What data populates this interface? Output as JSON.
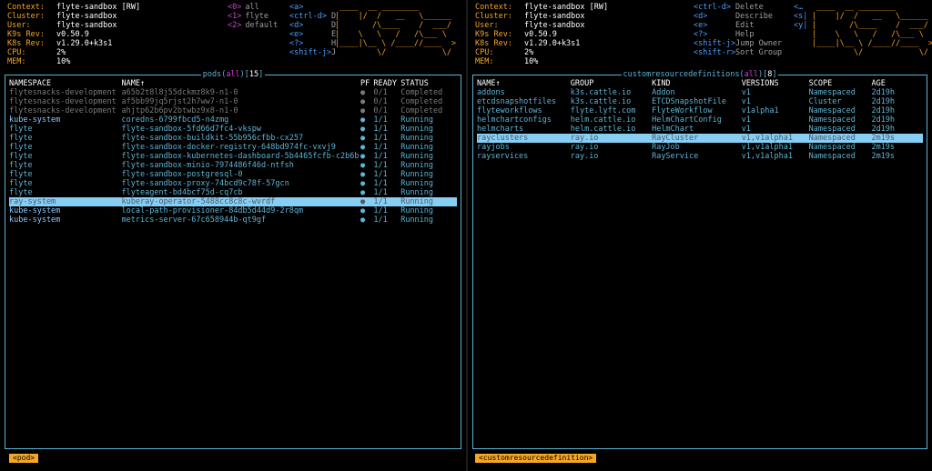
{
  "left": {
    "info": [
      {
        "key": "Context:",
        "value": "flyte-sandbox [RW]"
      },
      {
        "key": "Cluster:",
        "value": "flyte-sandbox"
      },
      {
        "key": "User:",
        "value": "flyte-sandbox"
      },
      {
        "key": "K9s Rev:",
        "value": "v0.50.9"
      },
      {
        "key": "K8s Rev:",
        "value": "v1.29.0+k3s1"
      },
      {
        "key": "CPU:",
        "value": "2%"
      },
      {
        "key": "MEM:",
        "value": "10%"
      }
    ],
    "namespaces": [
      {
        "key": "<0>",
        "value": "all"
      },
      {
        "key": "<1>",
        "value": "flyte"
      },
      {
        "key": "<2>",
        "value": "default"
      }
    ],
    "keys": [
      {
        "hint": "<a>",
        "desc": ""
      },
      {
        "hint": "<ctrl-d>",
        "desc": "D"
      },
      {
        "hint": "<d>",
        "desc": "D"
      },
      {
        "hint": "<e>",
        "desc": "E"
      },
      {
        "hint": "<?>",
        "desc": "H"
      },
      {
        "hint": "<shift-j>",
        "desc": "J"
      }
    ],
    "logo": " ____  __ ________\n|    |/  /   __   \\______\n|       /\\____    /  ___/\n|    \\   \\   /   /\\___ \\\n|____|\\__ \\ /____//____  >\n         \\/            \\/",
    "frame": {
      "name": "pods",
      "filter": "all",
      "count": "15"
    },
    "columns": [
      "NAMESPACE",
      "NAME↑",
      "PF",
      "READY",
      "STATUS"
    ],
    "rows": [
      {
        "ns": "flytesnacks-development",
        "name": "a65b2t8l8j55dckmz8k9-n1-0",
        "pf": "●",
        "ready": "0/1",
        "status": "Completed",
        "kind": "completed"
      },
      {
        "ns": "flytesnacks-development",
        "name": "af5bb99jq5rjst2h7ww7-n1-0",
        "pf": "●",
        "ready": "0/1",
        "status": "Completed",
        "kind": "completed"
      },
      {
        "ns": "flytesnacks-development",
        "name": "ahjtp62b6pv2btwbz9x8-n1-0",
        "pf": "●",
        "ready": "0/1",
        "status": "Completed",
        "kind": "completed"
      },
      {
        "ns": "kube-system",
        "name": "coredns-6799fbcd5-n4zmg",
        "pf": "●",
        "ready": "1/1",
        "status": "Running",
        "kind": "running"
      },
      {
        "ns": "flyte",
        "name": "flyte-sandbox-5fd66d7fc4-vkspw",
        "pf": "●",
        "ready": "1/1",
        "status": "Running",
        "kind": "running"
      },
      {
        "ns": "flyte",
        "name": "flyte-sandbox-buildkit-55b956cfbb-cx257",
        "pf": "●",
        "ready": "1/1",
        "status": "Running",
        "kind": "running"
      },
      {
        "ns": "flyte",
        "name": "flyte-sandbox-docker-registry-648bd974fc-vxvj9",
        "pf": "●",
        "ready": "1/1",
        "status": "Running",
        "kind": "running"
      },
      {
        "ns": "flyte",
        "name": "flyte-sandbox-kubernetes-dashboard-5b4465fcfb-c2b6b",
        "pf": "●",
        "ready": "1/1",
        "status": "Running",
        "kind": "running"
      },
      {
        "ns": "flyte",
        "name": "flyte-sandbox-minio-7974486f46d-ntfsh",
        "pf": "●",
        "ready": "1/1",
        "status": "Running",
        "kind": "running"
      },
      {
        "ns": "flyte",
        "name": "flyte-sandbox-postgresql-0",
        "pf": "●",
        "ready": "1/1",
        "status": "Running",
        "kind": "running"
      },
      {
        "ns": "flyte",
        "name": "flyte-sandbox-proxy-74bcd9c78f-57gcn",
        "pf": "●",
        "ready": "1/1",
        "status": "Running",
        "kind": "running"
      },
      {
        "ns": "flyte",
        "name": "flyteagent-bd4bcf75d-cq7cb",
        "pf": "●",
        "ready": "1/1",
        "status": "Running",
        "kind": "running"
      },
      {
        "ns": "ray-system",
        "name": "kuberay-operator-5488cc8c8c-wvrdf",
        "pf": "●",
        "ready": "1/1",
        "status": "Running",
        "kind": "selected"
      },
      {
        "ns": "kube-system",
        "name": "local-path-provisioner-84db5d44d9-2r8qm",
        "pf": "●",
        "ready": "1/1",
        "status": "Running",
        "kind": "running"
      },
      {
        "ns": "kube-system",
        "name": "metrics-server-67c658944b-qt9gf",
        "pf": "●",
        "ready": "1/1",
        "status": "Running",
        "kind": "running"
      }
    ],
    "crumb": "<pod>"
  },
  "right": {
    "info": [
      {
        "key": "Context:",
        "value": "flyte-sandbox [RW]"
      },
      {
        "key": "Cluster:",
        "value": "flyte-sandbox"
      },
      {
        "key": "User:",
        "value": "flyte-sandbox"
      },
      {
        "key": "K9s Rev:",
        "value": "v0.50.9"
      },
      {
        "key": "K8s Rev:",
        "value": "v1.29.0+k3s1"
      },
      {
        "key": "CPU:",
        "value": "2%"
      },
      {
        "key": "MEM:",
        "value": "10%"
      }
    ],
    "keys": [
      {
        "hint": "<ctrl-d>",
        "desc": "Delete"
      },
      {
        "hint": "<d>",
        "desc": "Describe"
      },
      {
        "hint": "<e>",
        "desc": "Edit"
      },
      {
        "hint": "<?>",
        "desc": "Help"
      },
      {
        "hint": "<shift-j>",
        "desc": "Jump Owner"
      },
      {
        "hint": "<shift-r>",
        "desc": "Sort Group"
      }
    ],
    "keys2": [
      {
        "hint": "<…",
        "desc": ""
      },
      {
        "hint": "<s|",
        "desc": ""
      },
      {
        "hint": "<y|",
        "desc": ""
      },
      {
        "hint": "",
        "desc": ""
      },
      {
        "hint": "",
        "desc": ""
      },
      {
        "hint": "",
        "desc": ""
      }
    ],
    "logo": " ____  __ ________\n|    |/  /   __   \\______\n|       /\\____    /  ___/\n|    \\   \\   /   /\\___ \\\n|____|\\__ \\ /____//____  >\n         \\/            \\/",
    "frame": {
      "name": "customresourcedefinitions",
      "filter": "all",
      "count": "8"
    },
    "columns": [
      "NAME↑",
      "GROUP",
      "KIND",
      "VERSIONS",
      "SCOPE",
      "AGE"
    ],
    "rows": [
      {
        "name": "addons",
        "group": "k3s.cattle.io",
        "kind_name": "Addon",
        "versions": "v1",
        "scope": "Namespaced",
        "age": "2d19h",
        "kind": "ok"
      },
      {
        "name": "etcdsnapshotfiles",
        "group": "k3s.cattle.io",
        "kind_name": "ETCDSnapshotFile",
        "versions": "v1",
        "scope": "Cluster",
        "age": "2d19h",
        "kind": "ok"
      },
      {
        "name": "flyteworkflows",
        "group": "flyte.lyft.com",
        "kind_name": "FlyteWorkflow",
        "versions": "v1alpha1",
        "scope": "Namespaced",
        "age": "2d19h",
        "kind": "ok"
      },
      {
        "name": "helmchartconfigs",
        "group": "helm.cattle.io",
        "kind_name": "HelmChartConfig",
        "versions": "v1",
        "scope": "Namespaced",
        "age": "2d19h",
        "kind": "ok"
      },
      {
        "name": "helmcharts",
        "group": "helm.cattle.io",
        "kind_name": "HelmChart",
        "versions": "v1",
        "scope": "Namespaced",
        "age": "2d19h",
        "kind": "ok"
      },
      {
        "name": "rayclusters",
        "group": "ray.io",
        "kind_name": "RayCluster",
        "versions": "v1,v1alpha1",
        "scope": "Namespaced",
        "age": "2m19s",
        "kind": "selected"
      },
      {
        "name": "rayjobs",
        "group": "ray.io",
        "kind_name": "RayJob",
        "versions": "v1,v1alpha1",
        "scope": "Namespaced",
        "age": "2m19s",
        "kind": "ok"
      },
      {
        "name": "rayservices",
        "group": "ray.io",
        "kind_name": "RayService",
        "versions": "v1,v1alpha1",
        "scope": "Namespaced",
        "age": "2m19s",
        "kind": "ok"
      }
    ],
    "crumb": "<customresourcedefinition>"
  }
}
